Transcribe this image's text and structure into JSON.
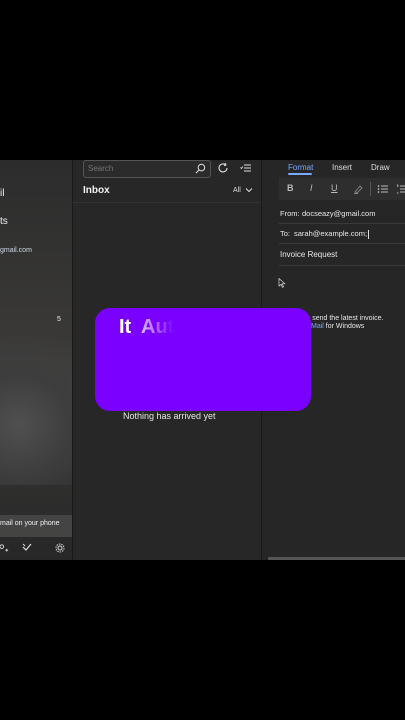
{
  "nav": {
    "fragment_top1": "il",
    "fragment_top2": "ts",
    "account_fragment": "gmail.com",
    "count": "5",
    "banner": "mail on your phone"
  },
  "list": {
    "search_placeholder": "Search",
    "title": "Inbox",
    "filter": "All",
    "empty_message": "Nothing has arrived yet"
  },
  "compose": {
    "tabs": [
      "Format",
      "Insert",
      "Draw"
    ],
    "format_buttons": [
      "B",
      "I",
      "U"
    ],
    "from_label": "From:",
    "from_value": "docseazy@gmail.com",
    "to_label": "To:",
    "to_value": "sarah@example.com;",
    "subject": "Invoice Request",
    "body_line1": "ase send the latest invoice.",
    "body_link": "Mail",
    "body_line2_suffix": " for Windows"
  },
  "overlay": {
    "word1": "It",
    "word2": "Aut"
  },
  "colors": {
    "accent": "#79a8ff",
    "overlay": "#7a00ff",
    "background": "#232323"
  }
}
